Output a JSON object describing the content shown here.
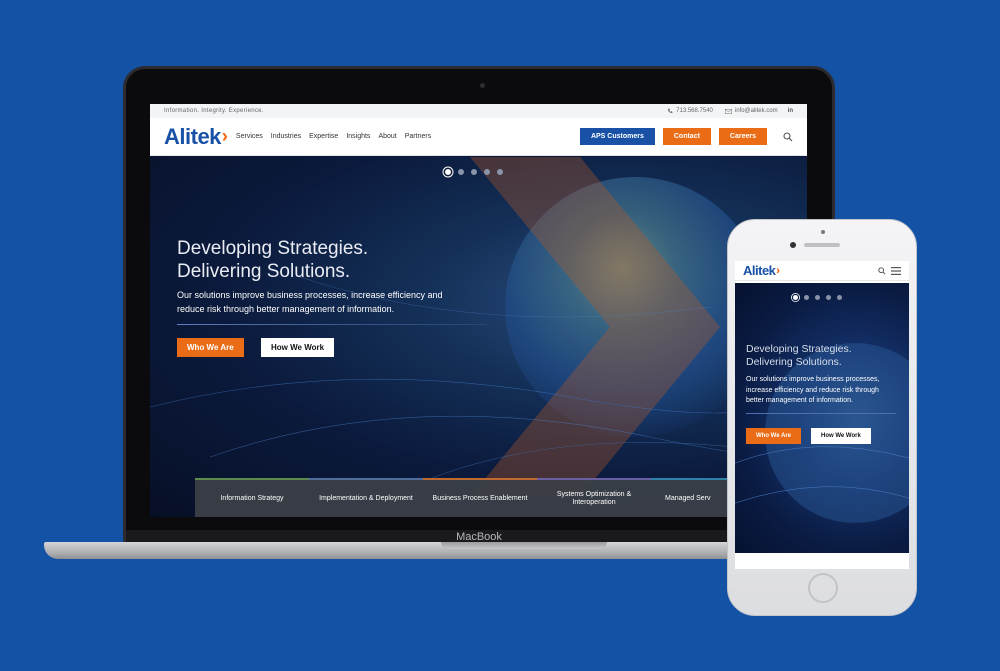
{
  "laptop": {
    "brand": "MacBook"
  },
  "desktop": {
    "topbar": {
      "tagline": "Information. Integrity. Experience.",
      "phone": "713.568.7540",
      "email": "info@alitek.com",
      "social": "in"
    },
    "logo": "Alitek",
    "nav": [
      "Services",
      "Industries",
      "Expertise",
      "Insights",
      "About",
      "Partners"
    ],
    "buttons": {
      "aps": "APS Customers",
      "contact": "Contact",
      "careers": "Careers"
    },
    "hero": {
      "title_line1": "Developing Strategies.",
      "title_line2": "Delivering Solutions.",
      "lead": "Our solutions improve business processes, increase efficiency and reduce risk through better management of information.",
      "btn_primary": "Who We Are",
      "btn_secondary": "How We Work",
      "slides_total": 5,
      "active_slide": 1
    },
    "services": [
      "Information Strategy",
      "Implementation & Deployment",
      "Business Process Enablement",
      "Systems Optimization & Interoperation",
      "Managed Serv"
    ]
  },
  "mobile": {
    "logo": "Alitek",
    "hero": {
      "title_line1": "Developing Strategies.",
      "title_line2": "Delivering Solutions.",
      "lead": "Our solutions improve business processes, increase efficiency and reduce risk through better management of information.",
      "btn_primary": "Who We Are",
      "btn_secondary": "How We Work"
    }
  },
  "colors": {
    "background": "#1452a6",
    "brand_blue": "#1851a6",
    "brand_orange": "#ea6c17"
  }
}
